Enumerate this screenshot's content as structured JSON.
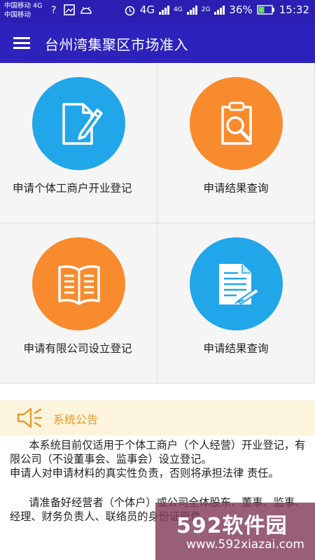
{
  "status_bar": {
    "carrier1": "中国移动 4G",
    "carrier2": "中国移动",
    "net1": "4G",
    "net2_top": "4G",
    "net3_top": "2G",
    "battery": "36%",
    "time": "15:32"
  },
  "app_bar": {
    "title": "台州湾集聚区市场准入",
    "menu_icon": "menu-icon"
  },
  "grid": {
    "tiles": [
      {
        "label": "申请个体工商户开业登记",
        "icon": "edit-document-icon",
        "color": "#21a6ea"
      },
      {
        "label": "申请结果查询",
        "icon": "clipboard-search-icon",
        "color": "#f88b2d"
      },
      {
        "label": "申请有限公司设立登记",
        "icon": "open-book-icon",
        "color": "#f88b2d"
      },
      {
        "label": "申请结果查询",
        "icon": "document-sign-icon",
        "color": "#21a6ea"
      }
    ]
  },
  "notice": {
    "icon": "speaker-icon",
    "title": "系统公告",
    "para1": "本系统目前仅适用于个体工商户（个人经营）开业登记，有限公司（不设董事会、监事会）设立登记。",
    "para2": "申请人对申请材料的真实性负责，否则将承担法律 责任。",
    "para3": "请准备好经营者（个体户）或公司全体股东、董事、监事、经理、财务负责人、联络员的身份证原件。"
  },
  "watermark": {
    "logo": "592软件园",
    "url": "www.592xiazai.com"
  },
  "colors": {
    "primary": "#2d22bb",
    "blue": "#21a6ea",
    "orange": "#f88b2d",
    "notice_bg": "#fdf4dd",
    "notice_title": "#e19a2f"
  }
}
